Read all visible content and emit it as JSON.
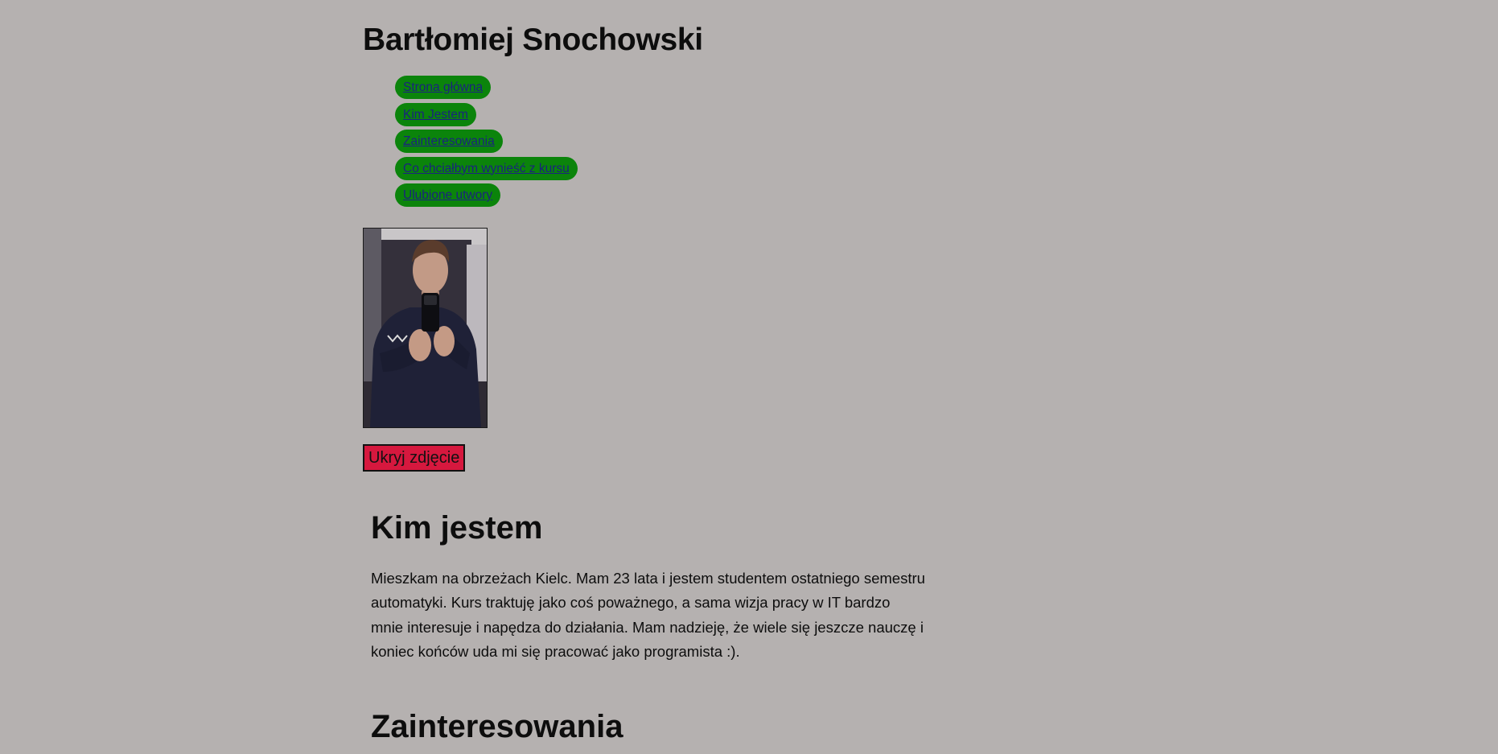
{
  "header": {
    "title": "Bartłomiej Snochowski"
  },
  "nav": {
    "items": [
      {
        "label": "Strona główna"
      },
      {
        "label": "Kim Jestem"
      },
      {
        "label": "Zainteresowania"
      },
      {
        "label": "Co chciałbym wynieść z kursu"
      },
      {
        "label": "Ulubione utwory"
      }
    ]
  },
  "photo": {
    "alt": "Zdjęcie"
  },
  "hide_button": {
    "label": "Ukryj zdjęcie"
  },
  "about": {
    "title": "Kim jestem",
    "text": "Mieszkam na obrzeżach Kielc. Mam 23 lata i jestem studentem ostatniego semestru automatyki. Kurs traktuję jako coś poważnego, a sama wizja pracy w IT bardzo mnie interesuje i napędza do działania. Mam nadzieję, że wiele się jeszcze nauczę i koniec końców uda mi się pracować jako programista :)."
  },
  "interests": {
    "title": "Zainteresowania"
  },
  "colors": {
    "background": "#b5b1b0",
    "nav_pill": "#0b840b",
    "nav_link": "#1a237e",
    "button": "#d6183e"
  }
}
